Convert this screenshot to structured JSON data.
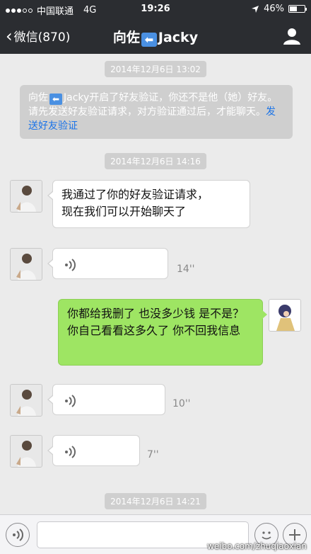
{
  "status_bar": {
    "carrier": "中国联通",
    "network": "4G",
    "time": "19:26",
    "battery": "46%",
    "battery_level": 0.46
  },
  "nav": {
    "back_label": "微信(870)",
    "title_prefix": "向佐",
    "title_emoji": "⬅",
    "title_suffix": "Jacky"
  },
  "chat": {
    "time1": "2014年12月6日 13:02",
    "system": {
      "text_a": "向佐",
      "emoji": "⬅",
      "text_b": "Jacky开启了好友验证，你还不是他（她）好友。请先发送好友验证请求，对方验证通过后，才能聊天。",
      "link": "发送好友验证"
    },
    "time2": "2014年12月6日 14:16",
    "msg1": "我通过了你的好友验证请求，\n现在我们可以开始聊天了",
    "voice1_duration": "14''",
    "msg2": "你都给我删了 也没多少钱 是不是？你自己看看这多久了 你不回我信息",
    "voice2_duration": "10''",
    "voice3_duration": "7''",
    "time3": "2014年12月6日 14:21"
  },
  "input": {
    "placeholder": ""
  },
  "watermark": "weibo.com/zhuqiaoxian",
  "colors": {
    "navbar": "#2b2d31",
    "background": "#ebebeb",
    "sent_bubble": "#9ee563",
    "link": "#1a73e8"
  }
}
